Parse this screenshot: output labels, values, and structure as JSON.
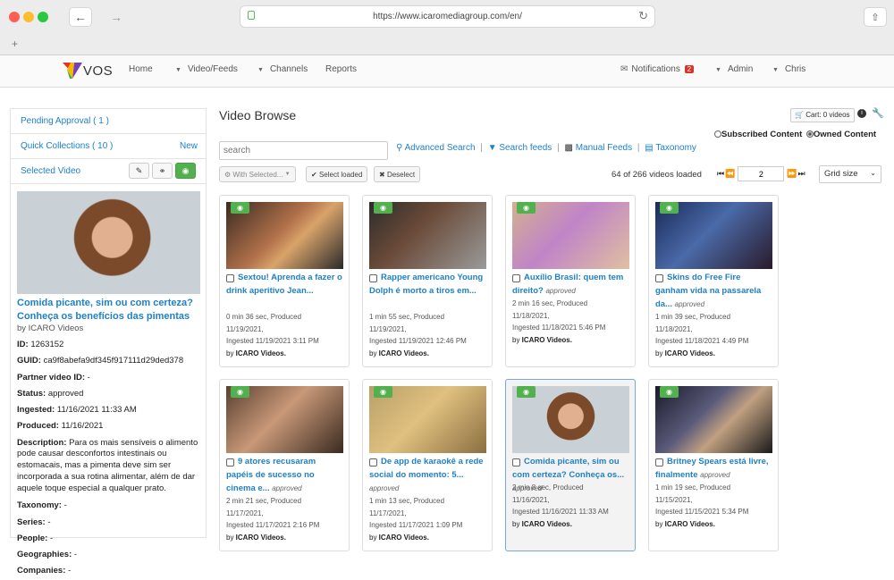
{
  "browser": {
    "url": "https://www.icaromediagroup.com/en/"
  },
  "nav": {
    "logo_text": "VOS",
    "home": "Home",
    "video_feeds": "Video/Feeds",
    "channels": "Channels",
    "reports": "Reports",
    "notifications": "Notifications",
    "notif_count": "2",
    "admin": "Admin",
    "user": "Chris"
  },
  "sidebar": {
    "pending": "Pending Approval ( 1 )",
    "quick": "Quick Collections ( 10 )",
    "new": "New",
    "selected": "Selected Video",
    "title": "Comida picante, sim ou com certeza? Conheça os benefícios das pimentas",
    "by": "by ICARO Videos",
    "meta": [
      {
        "k": "ID:",
        "v": "1263152"
      },
      {
        "k": "GUID:",
        "v": "ca9f8abefa9df345f917111d29ded378"
      },
      {
        "k": "Partner video ID:",
        "v": "-"
      },
      {
        "k": "Status:",
        "v": "approved"
      },
      {
        "k": "Ingested:",
        "v": "11/16/2021 11:33 AM"
      },
      {
        "k": "Produced:",
        "v": "11/16/2021"
      },
      {
        "k": "Description:",
        "v": "Para os mais sensíveis o alimento pode causar desconfortos intestinais ou estomacais, mas a pimenta deve sim ser incorporada a sua rotina alimentar, além de dar aquele toque especial a qualquer prato."
      },
      {
        "k": "Taxonomy:",
        "v": "-"
      },
      {
        "k": "Series:",
        "v": "-"
      },
      {
        "k": "People:",
        "v": "-"
      },
      {
        "k": "Geographies:",
        "v": "-"
      },
      {
        "k": "Companies:",
        "v": "-"
      }
    ]
  },
  "main": {
    "heading": "Video Browse",
    "cart": "Cart: 0 videos",
    "subscribed": "Subscribed Content",
    "owned": "Owned Content",
    "search_placeholder": "search",
    "advanced_search": "Advanced Search",
    "search_feeds": "Search feeds",
    "manual_feeds": "Manual Feeds",
    "taxonomy": "Taxonomy",
    "with_selected": "With Selected...",
    "select_loaded": "Select loaded",
    "deselect": "Deselect",
    "loaded": "64 of 266 videos loaded",
    "page": "2",
    "grid_size": "Grid size"
  },
  "cards": [
    {
      "title": "Sextou! Aprenda a fazer o drink aperitivo Jean...",
      "status": "",
      "line1": "0 min 36 sec, Produced",
      "line2": "11/19/2021,",
      "line3": "Ingested 11/19/2021 3:11 PM",
      "channel": "ICARO Videos."
    },
    {
      "title": "Rapper americano Young Dolph é morto a tiros em...",
      "status": "",
      "line1": "1 min 55 sec, Produced",
      "line2": "11/19/2021,",
      "line3": "Ingested 11/19/2021 12:46 PM",
      "channel": "ICARO Videos."
    },
    {
      "title": "Auxílio Brasil: quem tem direito?",
      "status": "approved",
      "line1": "2 min 16 sec, Produced",
      "line2": "11/18/2021,",
      "line3": "Ingested 11/18/2021 5:46 PM",
      "channel": "ICARO Videos."
    },
    {
      "title": "Skins do Free Fire ganham vida na passarela da...",
      "status": "approved",
      "line1": "1 min 39 sec, Produced",
      "line2": "11/18/2021,",
      "line3": "Ingested 11/18/2021 4:49 PM",
      "channel": "ICARO Videos."
    },
    {
      "title": "9 atores recusaram papéis de sucesso no cinema e...",
      "status": "approved",
      "line1": "2 min 21 sec, Produced",
      "line2": "11/17/2021,",
      "line3": "Ingested 11/17/2021 2:16 PM",
      "channel": "ICARO Videos."
    },
    {
      "title": "De app de karaokê a rede social do momento: 5...",
      "status": "approved",
      "line1": "1 min 13 sec, Produced",
      "line2": "11/17/2021,",
      "line3": "Ingested 11/17/2021 1:09 PM",
      "channel": "ICARO Videos."
    },
    {
      "title": "Comida picante, sim ou com certeza? Conheça os...",
      "status": "approved",
      "line1": "2 min 8 sec, Produced",
      "line2": "11/16/2021,",
      "line3": "Ingested 11/16/2021 11:33 AM",
      "channel": "ICARO Videos."
    },
    {
      "title": "Britney Spears está livre, finalmente",
      "status": "approved",
      "line1": "1 min 19 sec, Produced",
      "line2": "11/15/2021,",
      "line3": "Ingested 11/15/2021 5:34 PM",
      "channel": "ICARO Videos."
    }
  ]
}
